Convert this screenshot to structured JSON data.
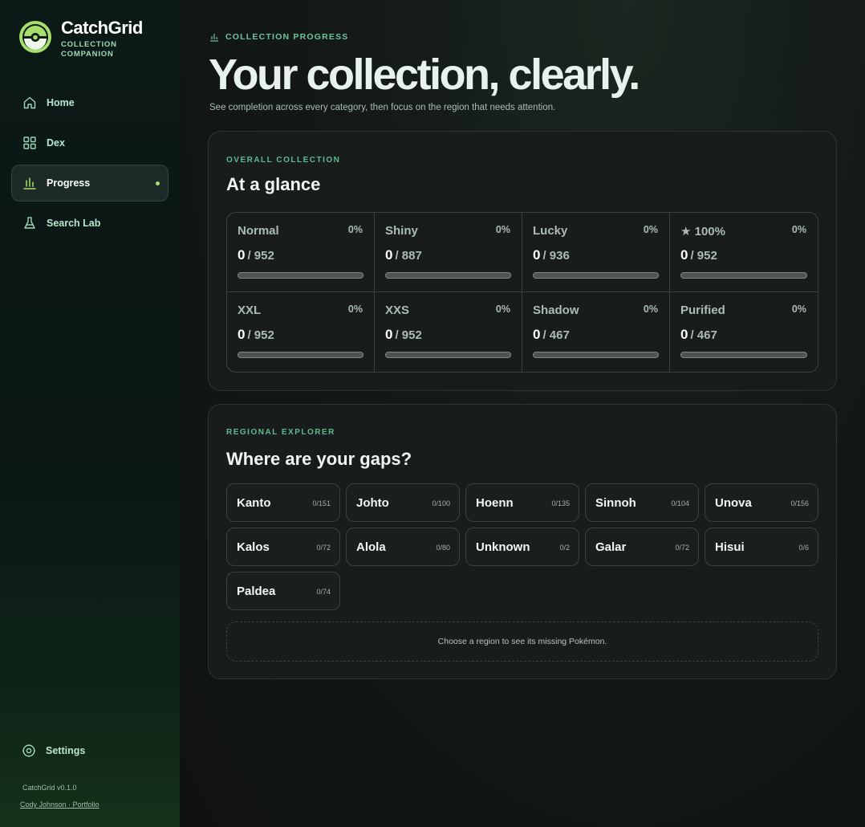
{
  "app": {
    "name": "CatchGrid",
    "subtitle": "COLLECTION COMPANION",
    "version": "CatchGrid v0.1.0",
    "author_link": "Cody Johnson · Portfolio"
  },
  "nav": {
    "items": [
      {
        "label": "Home",
        "icon": "home-icon"
      },
      {
        "label": "Dex",
        "icon": "grid-icon"
      },
      {
        "label": "Progress",
        "icon": "bar-chart-icon",
        "active": true
      },
      {
        "label": "Search Lab",
        "icon": "flask-icon"
      }
    ],
    "settings_label": "Settings"
  },
  "header": {
    "eyebrow": "COLLECTION PROGRESS",
    "title": "Your collection, clearly.",
    "subtitle": "See completion across every category, then focus on the region that needs attention."
  },
  "overall": {
    "eyebrow": "OVERALL COLLECTION",
    "title": "At a glance",
    "stats": [
      {
        "label": "Normal",
        "pct": "0%",
        "have": "0",
        "total": "/ 952",
        "progress": 0
      },
      {
        "label": "Shiny",
        "pct": "0%",
        "have": "0",
        "total": "/ 887",
        "progress": 0
      },
      {
        "label": "Lucky",
        "pct": "0%",
        "have": "0",
        "total": "/ 936",
        "progress": 0
      },
      {
        "label": "★ 100%",
        "pct": "0%",
        "have": "0",
        "total": "/ 952",
        "progress": 0
      },
      {
        "label": "XXL",
        "pct": "0%",
        "have": "0",
        "total": "/ 952",
        "progress": 0
      },
      {
        "label": "XXS",
        "pct": "0%",
        "have": "0",
        "total": "/ 952",
        "progress": 0
      },
      {
        "label": "Shadow",
        "pct": "0%",
        "have": "0",
        "total": "/ 467",
        "progress": 0
      },
      {
        "label": "Purified",
        "pct": "0%",
        "have": "0",
        "total": "/ 467",
        "progress": 0
      }
    ]
  },
  "regional": {
    "eyebrow": "REGIONAL EXPLORER",
    "title": "Where are your gaps?",
    "regions": [
      {
        "name": "Kanto",
        "count": "0/151"
      },
      {
        "name": "Johto",
        "count": "0/100"
      },
      {
        "name": "Hoenn",
        "count": "0/135"
      },
      {
        "name": "Sinnoh",
        "count": "0/104"
      },
      {
        "name": "Unova",
        "count": "0/156"
      },
      {
        "name": "Kalos",
        "count": "0/72"
      },
      {
        "name": "Alola",
        "count": "0/80"
      },
      {
        "name": "Unknown",
        "count": "0/2"
      },
      {
        "name": "Galar",
        "count": "0/72"
      },
      {
        "name": "Hisui",
        "count": "0/6"
      },
      {
        "name": "Paldea",
        "count": "0/74"
      }
    ],
    "empty_message": "Choose a region to see its missing Pokémon."
  },
  "colors": {
    "accent": "#a6e06a",
    "eyebrow": "#5fb991",
    "card_bg": "#181c1b"
  }
}
